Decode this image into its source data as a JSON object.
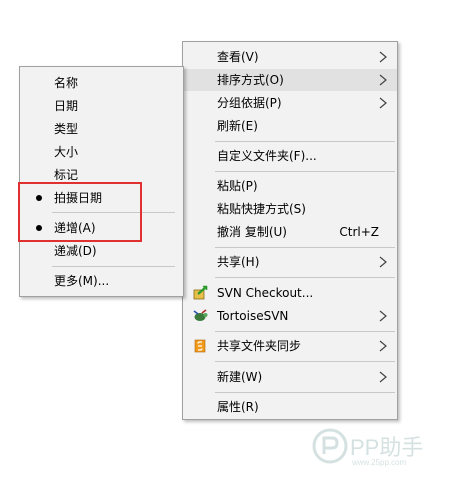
{
  "main_menu": {
    "items": [
      {
        "label": "查看(V)",
        "shortcut": ""
      },
      {
        "label": "排序方式(O)",
        "shortcut": ""
      },
      {
        "label": "分组依据(P)",
        "shortcut": ""
      },
      {
        "label": "刷新(E)",
        "shortcut": ""
      },
      {
        "label": "自定义文件夹(F)...",
        "shortcut": ""
      },
      {
        "label": "粘贴(P)",
        "shortcut": ""
      },
      {
        "label": "粘贴快捷方式(S)",
        "shortcut": ""
      },
      {
        "label": "撤消 复制(U)",
        "shortcut": "Ctrl+Z"
      },
      {
        "label": "共享(H)",
        "shortcut": ""
      },
      {
        "label": "SVN Checkout...",
        "shortcut": ""
      },
      {
        "label": "TortoiseSVN",
        "shortcut": ""
      },
      {
        "label": "共享文件夹同步",
        "shortcut": ""
      },
      {
        "label": "新建(W)",
        "shortcut": ""
      },
      {
        "label": "属性(R)",
        "shortcut": ""
      }
    ]
  },
  "sub_menu": {
    "items": [
      {
        "label": "名称",
        "checked": false
      },
      {
        "label": "日期",
        "checked": false
      },
      {
        "label": "类型",
        "checked": false
      },
      {
        "label": "大小",
        "checked": false
      },
      {
        "label": "标记",
        "checked": false
      },
      {
        "label": "拍摄日期",
        "checked": true
      },
      {
        "label": "递增(A)",
        "checked": true
      },
      {
        "label": "递减(D)",
        "checked": false
      },
      {
        "label": "更多(M)...",
        "checked": false
      }
    ]
  },
  "icons": {
    "submenu_arrow": "chevron-right-icon",
    "svn_checkout": "svn-checkout-icon",
    "tortoise_svn": "tortoise-svn-icon",
    "folder_sync": "folder-sync-icon",
    "selected": "bullet-icon"
  },
  "colors": {
    "menu_bg": "#f2f2f2",
    "highlight": "#e1e1e1",
    "annotation_box": "#e03030"
  },
  "watermark": {
    "text": "PP助手",
    "sub": "www.25pp.com"
  }
}
